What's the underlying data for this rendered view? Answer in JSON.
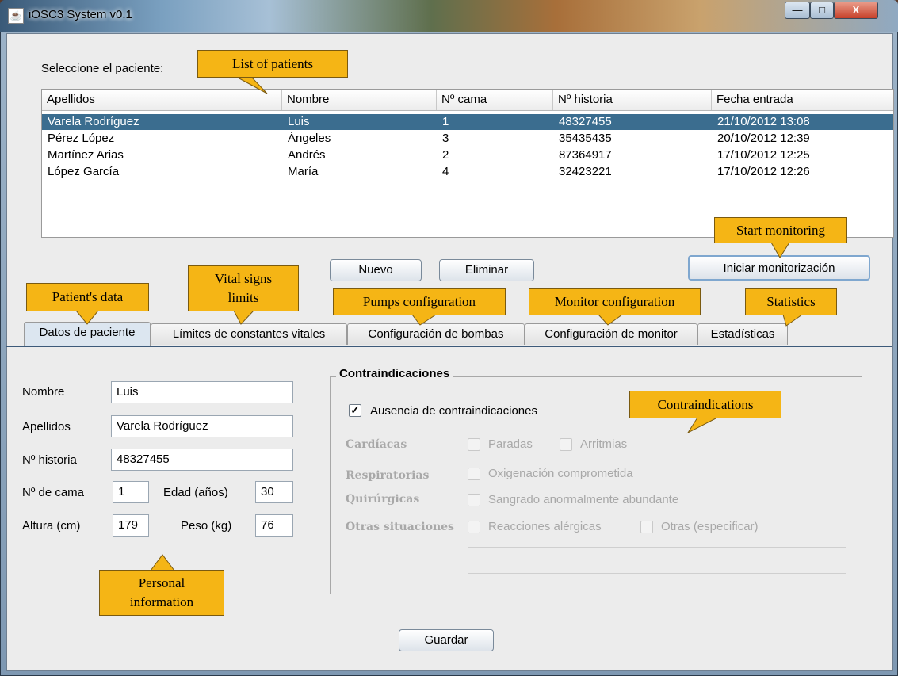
{
  "window": {
    "title": "iOSC3 System v0.1",
    "minimize": "—",
    "maximize": "□",
    "close": "X"
  },
  "select_label": "Seleccione el paciente:",
  "table": {
    "headers": [
      "Apellidos",
      "Nombre",
      "Nº cama",
      "Nº historia",
      "Fecha entrada"
    ],
    "rows": [
      [
        "Varela Rodríguez",
        "Luis",
        "1",
        "48327455",
        "21/10/2012 13:08"
      ],
      [
        "Pérez López",
        "Ángeles",
        "3",
        "35435435",
        "20/10/2012 12:39"
      ],
      [
        "Martínez Arias",
        "Andrés",
        "2",
        "87364917",
        "17/10/2012 12:25"
      ],
      [
        "López García",
        "María",
        "4",
        "32423221",
        "17/10/2012 12:26"
      ]
    ]
  },
  "buttons": {
    "nuevo": "Nuevo",
    "eliminar": "Eliminar",
    "iniciar": "Iniciar monitorización",
    "guardar": "Guardar"
  },
  "tabs": [
    {
      "label": "Datos de paciente",
      "active": true
    },
    {
      "label": "Límites de constantes vitales"
    },
    {
      "label": "Configuración de bombas"
    },
    {
      "label": "Configuración de monitor"
    },
    {
      "label": "Estadísticas"
    }
  ],
  "form": {
    "nombre_label": "Nombre",
    "nombre": "Luis",
    "apellidos_label": "Apellidos",
    "apellidos": "Varela Rodríguez",
    "historia_label": "Nº historia",
    "historia": "48327455",
    "cama_label": "Nº de cama",
    "cama": "1",
    "edad_label": "Edad (años)",
    "edad": "30",
    "altura_label": "Altura (cm)",
    "altura": "179",
    "peso_label": "Peso (kg)",
    "peso": "76"
  },
  "contra": {
    "title": "Contraindicaciones",
    "ausencia": "Ausencia de contraindicaciones",
    "ausencia_checked": "✓",
    "cardiacas": "Cardíacas",
    "paradas": "Paradas",
    "arritmias": "Arritmias",
    "respiratorias": "Respiratorias",
    "oxigenacion": "Oxigenación comprometida",
    "quirurgicas": "Quirúrgicas",
    "sangrado": "Sangrado anormalmente abundante",
    "otras_situaciones": "Otras situaciones",
    "reacciones": "Reacciones alérgicas",
    "otras": "Otras (especificar)"
  },
  "callouts": {
    "list": "List of patients",
    "start": "Start monitoring",
    "patient": "Patient's data",
    "vital_1": "Vital signs",
    "vital_2": "limits",
    "pumps": "Pumps configuration",
    "monitor": "Monitor configuration",
    "statistics": "Statistics",
    "contra": "Contraindications",
    "personal_1": "Personal",
    "personal_2": "information"
  },
  "colors": {
    "selected_row": "#3b6d8f",
    "callout": "#f5b515"
  }
}
